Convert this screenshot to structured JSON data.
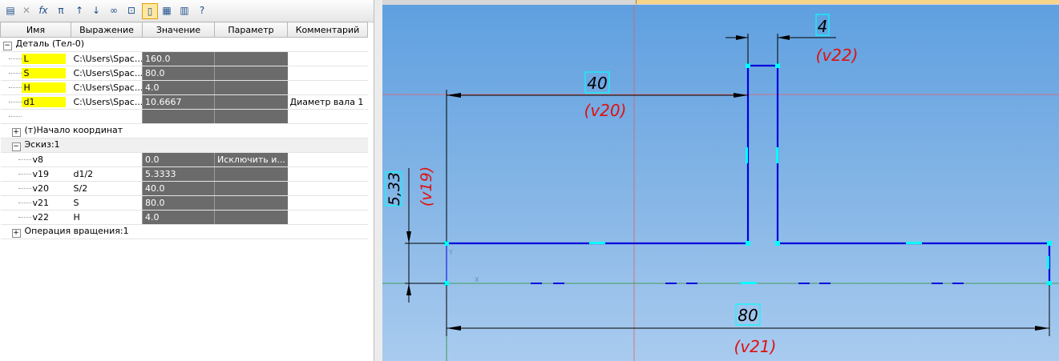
{
  "columns": [
    "Имя",
    "Выражение",
    "Значение",
    "Параметр",
    "Комментарий"
  ],
  "part": {
    "label": "Деталь (Тел-0)"
  },
  "part_rows": [
    {
      "name": "L",
      "expr": "C:\\Users\\Spac...",
      "value": "160.0",
      "param": "",
      "comment": ""
    },
    {
      "name": "S",
      "expr": "C:\\Users\\Spac...",
      "value": "80.0",
      "param": "",
      "comment": ""
    },
    {
      "name": "H",
      "expr": "C:\\Users\\Spac...",
      "value": "4.0",
      "param": "",
      "comment": ""
    },
    {
      "name": "d1",
      "expr": "C:\\Users\\Spac...",
      "value": "10.6667",
      "param": "",
      "comment": "Диаметр вала 1"
    }
  ],
  "origin": {
    "label": "(т)Начало координат"
  },
  "sketch": {
    "label": "Эскиз:1"
  },
  "sketch_rows": [
    {
      "name": "v8",
      "expr": "",
      "value": "0.0",
      "param": "Исключить и...",
      "comment": ""
    },
    {
      "name": "v19",
      "expr": "d1/2",
      "value": "5.3333",
      "param": "",
      "comment": ""
    },
    {
      "name": "v20",
      "expr": "S/2",
      "value": "40.0",
      "param": "",
      "comment": ""
    },
    {
      "name": "v21",
      "expr": "S",
      "value": "80.0",
      "param": "",
      "comment": ""
    },
    {
      "name": "v22",
      "expr": "H",
      "value": "4.0",
      "param": "",
      "comment": ""
    }
  ],
  "revolve": {
    "label": "Операция вращения:1"
  },
  "drawing": {
    "dim_top_value": "4",
    "dim_top_var": "(v22)",
    "dim_mid_value": "40",
    "dim_mid_var": "(v20)",
    "dim_left_value": "5,33",
    "dim_left_var": "(v19)",
    "dim_bottom_value": "80",
    "dim_bottom_var": "(v21)",
    "axis_x": "X",
    "axis_y": "Y"
  },
  "colors": {
    "sketch_line": "#0000dd",
    "dimension": "#000000",
    "variable": "#e01010",
    "point": "#00ffff"
  }
}
